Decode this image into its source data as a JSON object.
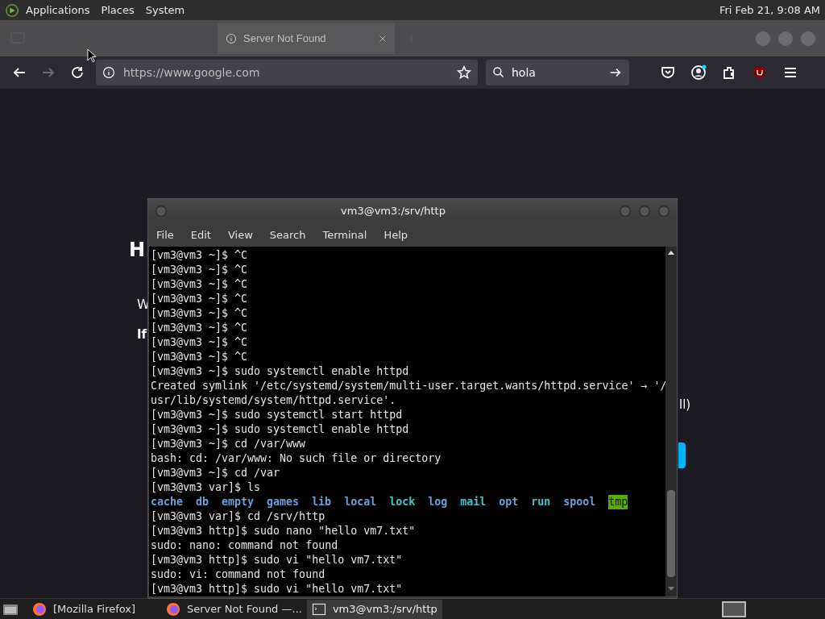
{
  "top_panel": {
    "menus": [
      "Applications",
      "Places",
      "System"
    ],
    "clock": "Fri Feb 21, 9:08 AM"
  },
  "browser": {
    "tabs": [
      {
        "label": "Server Not Found",
        "selected": true
      }
    ],
    "url": "https://www.google.com",
    "search": {
      "value": "hola"
    },
    "page_fragments": [
      {
        "kind": "heading",
        "text": "H"
      },
      {
        "kind": "line",
        "text": "W"
      },
      {
        "kind": "bold-line",
        "text": "If"
      },
      {
        "kind": "right-line",
        "text": "ll)"
      }
    ]
  },
  "terminal": {
    "title": "vm3@vm3:/srv/http",
    "menus": [
      "File",
      "Edit",
      "View",
      "Search",
      "Terminal",
      "Help"
    ],
    "lines": [
      {
        "kind": "text",
        "text": "[vm3@vm3 ~]$ ^C"
      },
      {
        "kind": "text",
        "text": "[vm3@vm3 ~]$ ^C"
      },
      {
        "kind": "text",
        "text": "[vm3@vm3 ~]$ ^C"
      },
      {
        "kind": "text",
        "text": "[vm3@vm3 ~]$ ^C"
      },
      {
        "kind": "text",
        "text": "[vm3@vm3 ~]$ ^C"
      },
      {
        "kind": "text",
        "text": "[vm3@vm3 ~]$ ^C"
      },
      {
        "kind": "text",
        "text": "[vm3@vm3 ~]$ ^C"
      },
      {
        "kind": "text",
        "text": "[vm3@vm3 ~]$ ^C"
      },
      {
        "kind": "text",
        "text": "[vm3@vm3 ~]$ sudo systemctl enable httpd"
      },
      {
        "kind": "text",
        "text": "Created symlink '/etc/systemd/system/multi-user.target.wants/httpd.service' → '/"
      },
      {
        "kind": "text",
        "text": "usr/lib/systemd/system/httpd.service'."
      },
      {
        "kind": "text",
        "text": "[vm3@vm3 ~]$ sudo systemctl start httpd"
      },
      {
        "kind": "text",
        "text": "[vm3@vm3 ~]$ sudo systemctl enable httpd"
      },
      {
        "kind": "text",
        "text": "[vm3@vm3 ~]$ cd /var/www"
      },
      {
        "kind": "text",
        "text": "bash: cd: /var/www: No such file or directory"
      },
      {
        "kind": "text",
        "text": "[vm3@vm3 ~]$ cd /var"
      },
      {
        "kind": "text",
        "text": "[vm3@vm3 var]$ ls"
      },
      {
        "kind": "ls",
        "items": [
          {
            "name": "cache",
            "kind": "dir"
          },
          {
            "name": "db",
            "kind": "dir"
          },
          {
            "name": "empty",
            "kind": "dir"
          },
          {
            "name": "games",
            "kind": "dir"
          },
          {
            "name": "lib",
            "kind": "dir"
          },
          {
            "name": "local",
            "kind": "dir"
          },
          {
            "name": "lock",
            "kind": "link"
          },
          {
            "name": "log",
            "kind": "dir"
          },
          {
            "name": "mail",
            "kind": "link"
          },
          {
            "name": "opt",
            "kind": "dir"
          },
          {
            "name": "run",
            "kind": "link"
          },
          {
            "name": "spool",
            "kind": "dir"
          },
          {
            "name": "tmp",
            "kind": "sticky"
          }
        ]
      },
      {
        "kind": "text",
        "text": "[vm3@vm3 var]$ cd /srv/http"
      },
      {
        "kind": "text",
        "text": "[vm3@vm3 http]$ sudo nano \"hello vm7.txt\""
      },
      {
        "kind": "text",
        "text": "sudo: nano: command not found"
      },
      {
        "kind": "text",
        "text": "[vm3@vm3 http]$ sudo vi \"hello vm7.txt\""
      },
      {
        "kind": "text",
        "text": "sudo: vi: command not found"
      },
      {
        "kind": "text",
        "text": "[vm3@vm3 http]$ sudo vi \"hello vm7.txt\""
      }
    ]
  },
  "taskbar": {
    "items": [
      {
        "label": "[Mozilla Firefox]",
        "selected": false,
        "kind": "browser"
      },
      {
        "label": "Server Not Found —...",
        "selected": false,
        "kind": "browser"
      },
      {
        "label": "vm3@vm3:/srv/http",
        "selected": true,
        "kind": "terminal"
      }
    ]
  }
}
